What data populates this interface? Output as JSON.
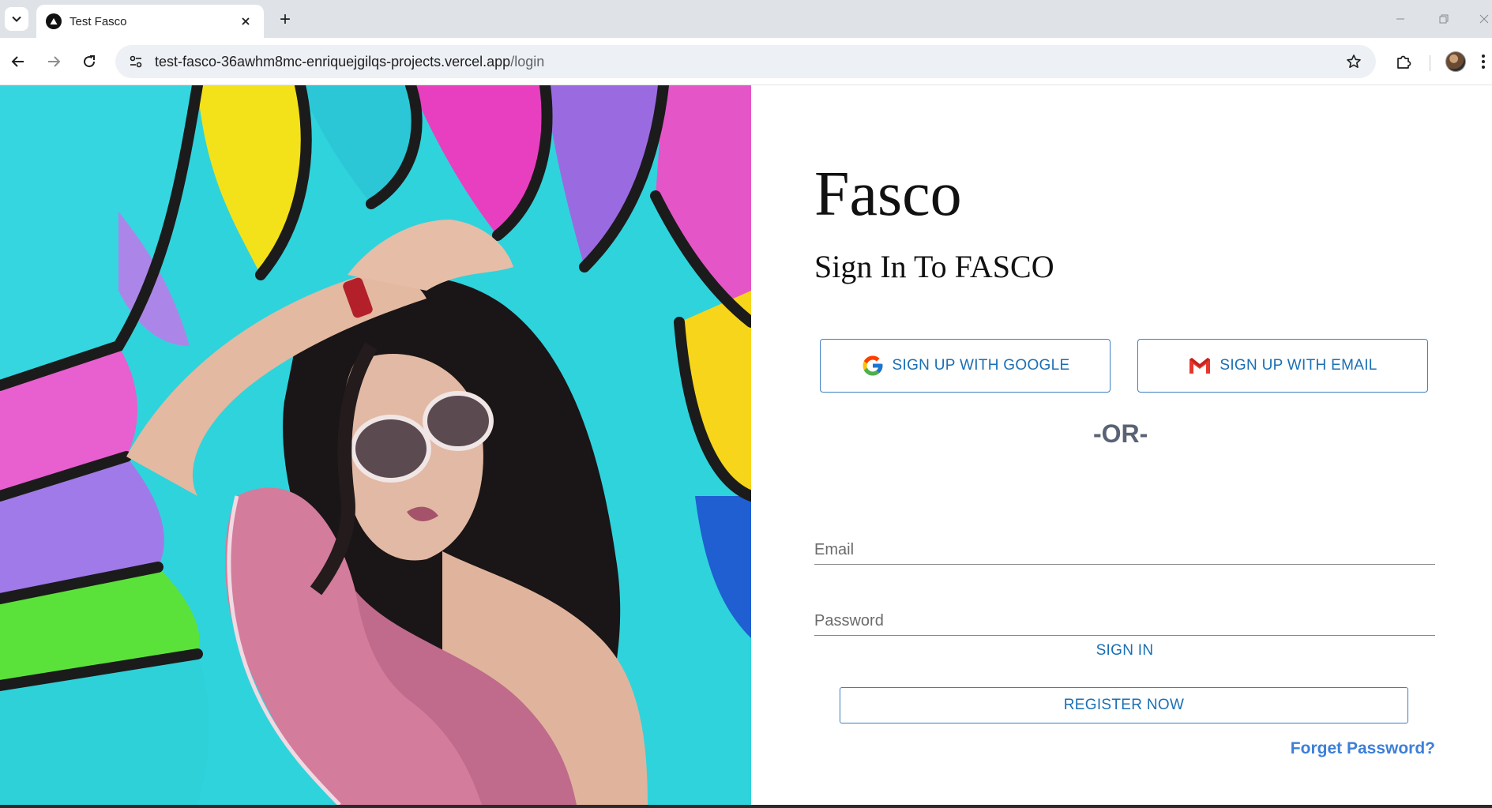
{
  "browser": {
    "tab_title": "Test Fasco",
    "url_host": "test-fasco-36awhm8mc-enriquejgilqs-projects.vercel.app",
    "url_path": "/login",
    "new_tab_symbol": "+",
    "icons": {
      "tab_menu": "chevron-down-icon",
      "favicon": "vercel-triangle-icon",
      "close": "close-icon",
      "back": "arrow-left-icon",
      "forward": "arrow-right-icon",
      "reload": "reload-icon",
      "site_info": "tune-icon",
      "bookmark": "star-icon",
      "extensions": "puzzle-icon",
      "profile": "avatar-icon",
      "menu": "more-vert-icon"
    }
  },
  "login": {
    "brand": "Fasco",
    "title": "Sign In To FASCO",
    "google_button": "SIGN UP WITH GOOGLE",
    "email_button": "SIGN UP WITH EMAIL",
    "divider": "-OR-",
    "email_placeholder": "Email",
    "password_placeholder": "Password",
    "sign_in": "SIGN IN",
    "register": "REGISTER NOW",
    "forget_password": "Forget Password?"
  },
  "colors": {
    "accent": "#1a6fb4",
    "link": "#3d7fd9",
    "button_border": "#3d7fc0",
    "divider_text": "#5a6275",
    "tabstrip": "#dfe3e8",
    "omnibox": "#edf0f4"
  }
}
